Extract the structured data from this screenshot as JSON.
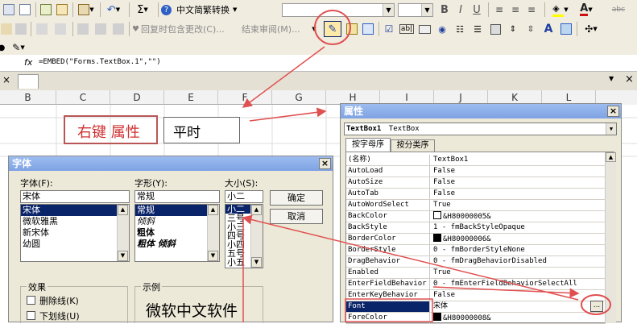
{
  "toolbar1": {
    "convert_label": "中文简繁转换",
    "font_name": "",
    "font_size": "",
    "bold": "B",
    "italic": "I",
    "underline": "U",
    "sigma": "Σ",
    "abc": "abc"
  },
  "toolbar2": {
    "reply_label": "回复时包含更改(C)...",
    "end_review_label": "结束审阅(M)...",
    "label_A": "A"
  },
  "formula": {
    "fx": "fx",
    "content": "=EMBED(\"Forms.TextBox.1\",\"\")"
  },
  "columns": [
    "B",
    "C",
    "D",
    "E",
    "F",
    "G",
    "H",
    "I",
    "J",
    "K",
    "L"
  ],
  "sheet": {
    "annotation": "右键 属性",
    "textbox_text": "平时"
  },
  "font_dialog": {
    "title": "字体",
    "font_label": "字体(F):",
    "style_label": "字形(Y):",
    "size_label": "大小(S):",
    "font_value": "宋体",
    "style_value": "常规",
    "size_value": "小二",
    "font_items": [
      "宋体",
      "微软雅黑",
      "新宋体",
      "幼圆"
    ],
    "style_items": [
      "常规",
      "倾斜",
      "粗体",
      "粗体 倾斜"
    ],
    "size_items": [
      "小二",
      "三号",
      "小三",
      "四号",
      "小四",
      "五号",
      "小五"
    ],
    "ok_label": "确定",
    "cancel_label": "取消",
    "effects_label": "效果",
    "strikeout_label": "删除线(K)",
    "underline_label": "下划线(U)",
    "sample_label": "示例",
    "sample_text": "微软中文软件"
  },
  "properties": {
    "title": "属性",
    "object_name": "TextBox1",
    "object_type": "TextBox",
    "tab_alpha": "按字母序",
    "tab_category": "按分类序",
    "rows": [
      {
        "name": "(名称)",
        "value": "TextBox1"
      },
      {
        "name": "AutoLoad",
        "value": "False"
      },
      {
        "name": "AutoSize",
        "value": "False"
      },
      {
        "name": "AutoTab",
        "value": "False"
      },
      {
        "name": "AutoWordSelect",
        "value": "True"
      },
      {
        "name": "BackColor",
        "value": "&H80000005&"
      },
      {
        "name": "BackStyle",
        "value": "1 - fmBackStyleOpaque"
      },
      {
        "name": "BorderColor",
        "value": "&H80000006&"
      },
      {
        "name": "BorderStyle",
        "value": "0 - fmBorderStyleNone"
      },
      {
        "name": "DragBehavior",
        "value": "0 - fmDragBehaviorDisabled"
      },
      {
        "name": "Enabled",
        "value": "True"
      },
      {
        "name": "EnterFieldBehavior",
        "value": "0 - fmEnterFieldBehaviorSelectAll"
      },
      {
        "name": "EnterKeyBehavior",
        "value": "False"
      },
      {
        "name": "Font",
        "value": "宋体"
      },
      {
        "name": "ForeColor",
        "value": "&H80000008&"
      }
    ],
    "ellipsis": "..."
  },
  "colors": {
    "annotation_red": "#e05050",
    "selection": "#0a246a",
    "title_blue": "#7ea2e3"
  }
}
